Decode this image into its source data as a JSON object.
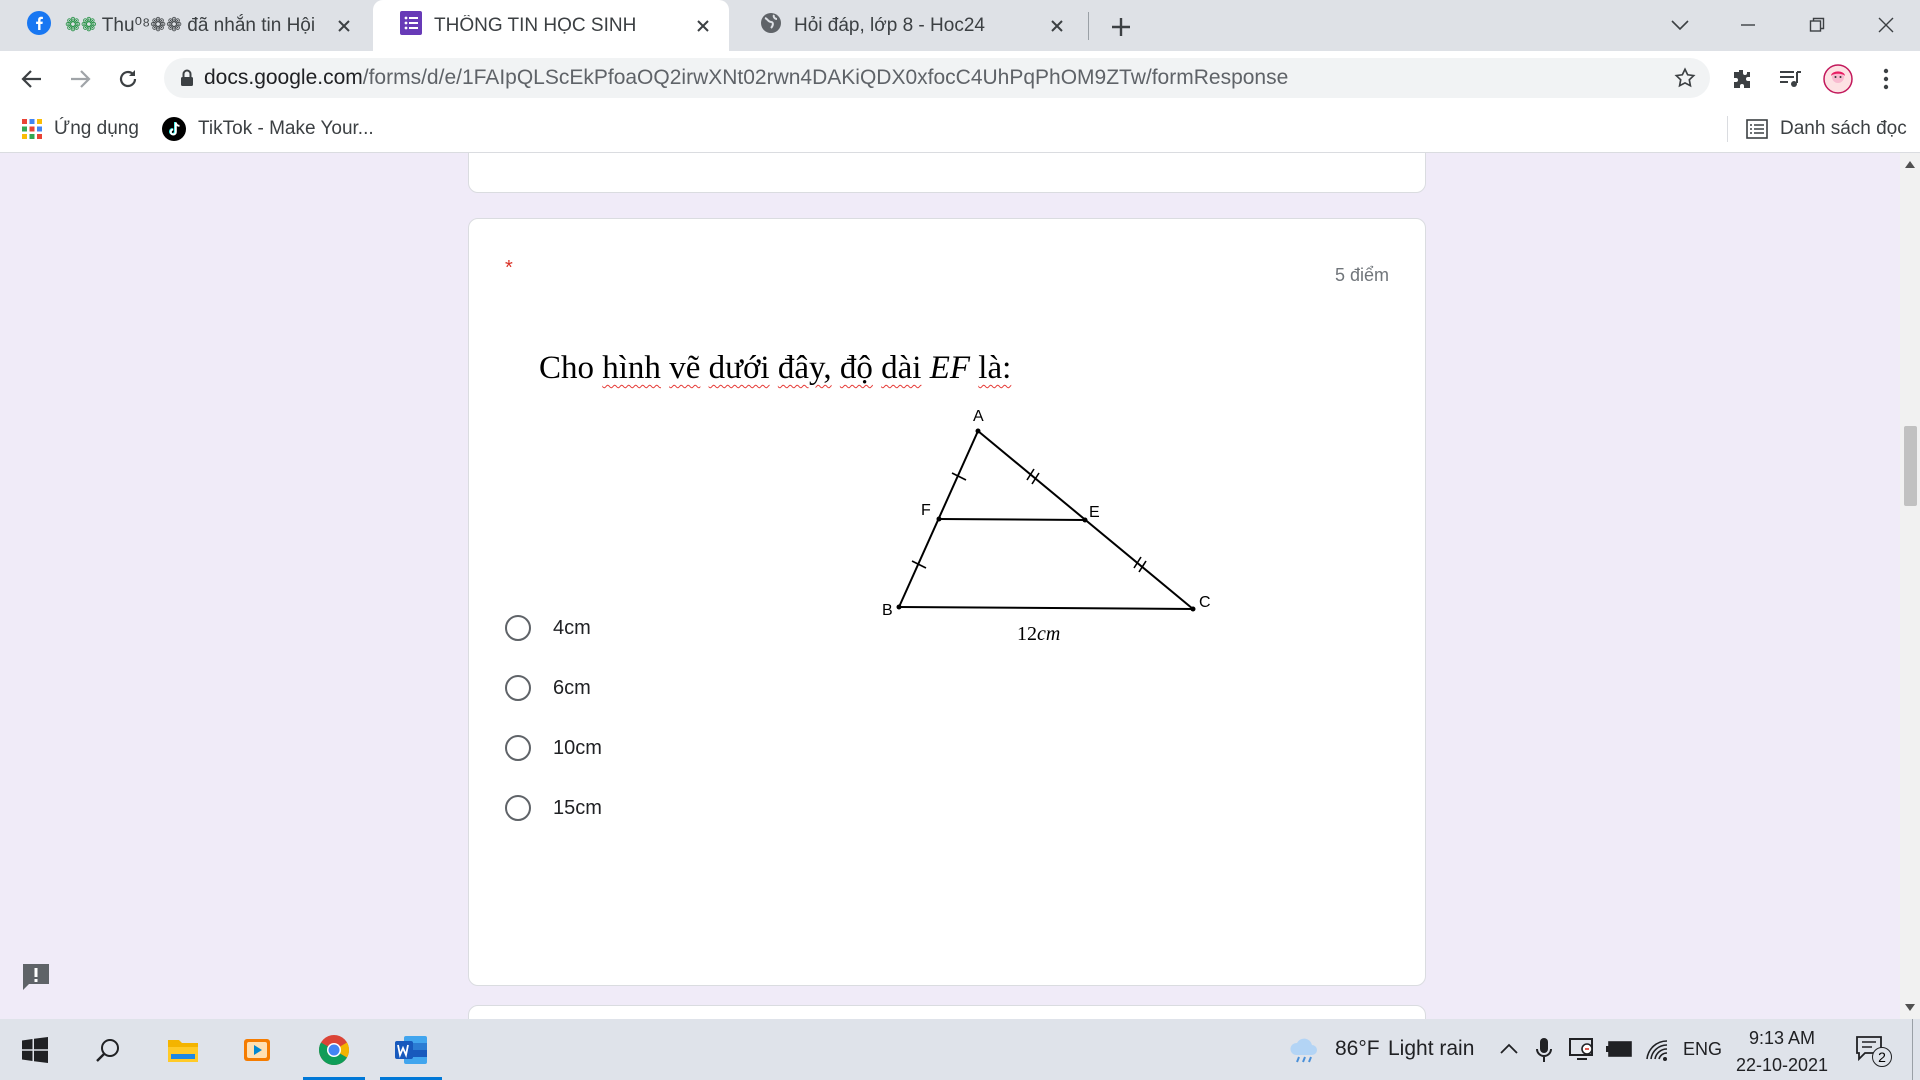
{
  "browser": {
    "tabs": [
      {
        "title": "Thu⁰⁸❁❁ đã nhắn tin Hội",
        "prefix": "❁❁",
        "icon": "facebook-icon"
      },
      {
        "title": "THÔNG TIN HỌC SINH",
        "icon": "google-forms-icon"
      },
      {
        "title": "Hỏi đáp, lớp 8 - Hoc24",
        "icon": "globe-icon"
      }
    ],
    "url_host": "docs.google.com",
    "url_path": "/forms/d/e/1FAIpQLScEkPfoaOQ2irwXNt02rwn4DAKiQDX0xfocC4UhPqPhOM9ZTw/formResponse",
    "bookmarks": [
      {
        "label": "Ứng dụng",
        "icon": "apps-grid-icon"
      },
      {
        "label": "TikTok - Make Your...",
        "icon": "tiktok-icon"
      }
    ],
    "reading_list": "Danh sách đọc"
  },
  "question": {
    "required_mark": "*",
    "points": "5 điểm",
    "text_prefix": "Cho",
    "text_words": [
      "hình",
      "vẽ",
      "dưới",
      "đây,",
      "độ",
      "dài"
    ],
    "text_math": "EF",
    "text_suffix": "là:",
    "figure": {
      "labels": {
        "A": "A",
        "B": "B",
        "C": "C",
        "E": "E",
        "F": "F"
      },
      "base_number": "12",
      "base_unit": "cm"
    },
    "options": [
      {
        "label": "4cm",
        "selected": false
      },
      {
        "label": "6cm",
        "selected": false
      },
      {
        "label": "10cm",
        "selected": false
      },
      {
        "label": "15cm",
        "selected": false
      }
    ]
  },
  "taskbar": {
    "weather_temp": "86°F",
    "weather_desc": "Light rain",
    "language": "ENG",
    "time": "9:13 AM",
    "date": "22-10-2021",
    "notification_count": "2",
    "apps": [
      "windows-start-icon",
      "search-icon",
      "file-explorer-icon",
      "media-player-icon",
      "chrome-icon",
      "word-icon"
    ]
  },
  "colors": {
    "page_bg": "#f0ebf8",
    "required": "#d93025",
    "forms_purple": "#673ab7",
    "taskbar_active": "#0078d7"
  }
}
